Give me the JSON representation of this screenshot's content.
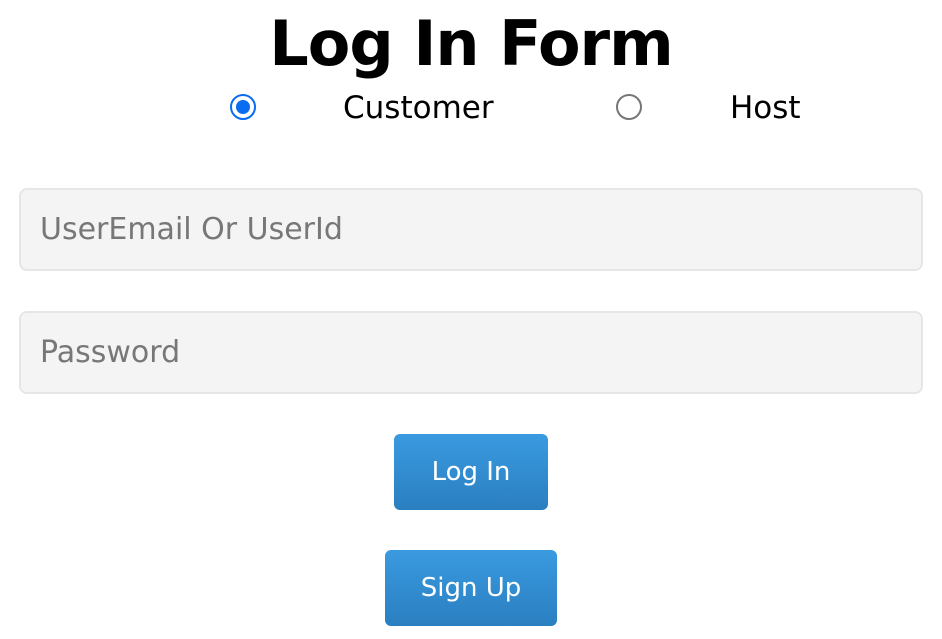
{
  "form": {
    "title": "Log In Form",
    "roles": [
      {
        "label": "Customer",
        "checked": true
      },
      {
        "label": "Host",
        "checked": false
      }
    ],
    "email_field": {
      "value": "",
      "placeholder": "UserEmail Or UserId"
    },
    "password_field": {
      "value": "",
      "placeholder": "Password"
    },
    "login_button": "Log In",
    "signup_button": "Sign Up"
  },
  "colors": {
    "accent": "#0a6cf0",
    "button": "#2f8ad0",
    "field_bg": "#f4f4f4"
  }
}
